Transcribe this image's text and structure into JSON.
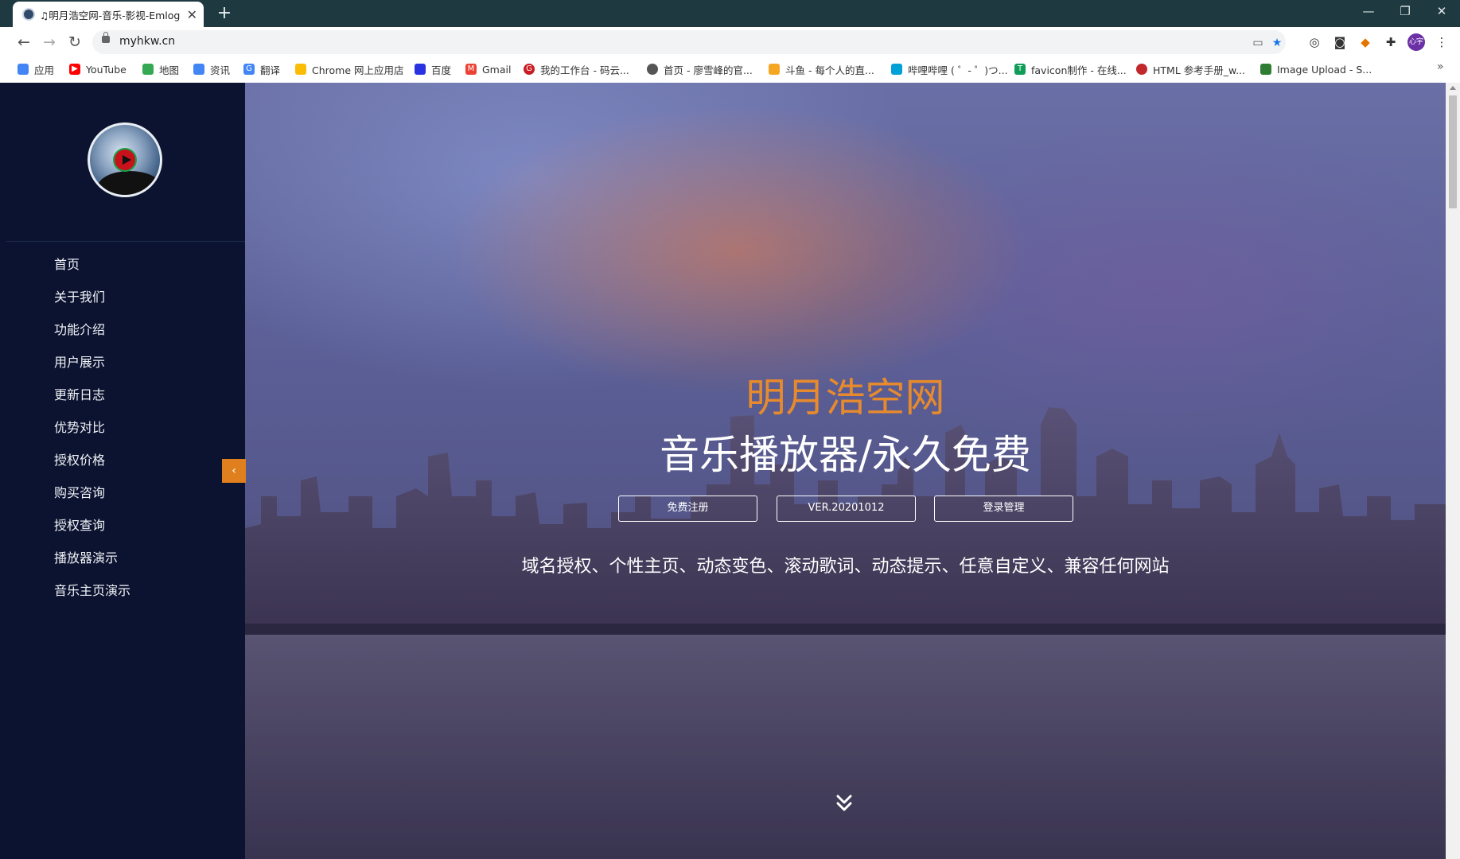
{
  "browser": {
    "tab_title": "♫明月浩空网-音乐-影视-Emlog",
    "url": "myhkw.cn",
    "new_tab_label": "+",
    "close_glyph": "✕",
    "profile_label": "心宇",
    "bookmarks": [
      {
        "label": "应用",
        "icon": "apps-grid-icon",
        "color": "#4285f4"
      },
      {
        "label": "YouTube",
        "icon": "youtube-icon",
        "color": "#ff0000"
      },
      {
        "label": "地图",
        "icon": "maps-icon",
        "color": "#34a853"
      },
      {
        "label": "资讯",
        "icon": "news-icon",
        "color": "#4285f4"
      },
      {
        "label": "翻译",
        "icon": "translate-icon",
        "color": "#4285f4"
      },
      {
        "label": "Chrome 网上应用店",
        "icon": "webstore-icon",
        "color": "#fbbc05"
      },
      {
        "label": "百度",
        "icon": "baidu-icon",
        "color": "#2932e1"
      },
      {
        "label": "Gmail",
        "icon": "gmail-icon",
        "color": "#ea4335"
      },
      {
        "label": "我的工作台 - 码云...",
        "icon": "gitee-icon",
        "color": "#c71d23"
      },
      {
        "label": "首页 - 廖雪峰的官...",
        "icon": "globe-icon",
        "color": "#555555"
      },
      {
        "label": "斗鱼 - 每个人的直...",
        "icon": "douyu-icon",
        "color": "#f5a623"
      },
      {
        "label": "哔哩哔哩 ( ゜- ゜)つ...",
        "icon": "bilibili-icon",
        "color": "#00a1d6"
      },
      {
        "label": "favicon制作 - 在线...",
        "icon": "favicon-icon",
        "color": "#0f9d58"
      },
      {
        "label": "HTML 参考手册_w...",
        "icon": "w3school-icon",
        "color": "#c1272d"
      },
      {
        "label": "Image Upload - S...",
        "icon": "bar-chart-icon",
        "color": "#2e7d32"
      }
    ],
    "more_glyph": "»"
  },
  "sidebar": {
    "menu": [
      "首页",
      "关于我们",
      "功能介绍",
      "用户展示",
      "更新日志",
      "优势对比",
      "授权价格",
      "购买咨询",
      "授权查询",
      "播放器演示",
      "音乐主页演示"
    ],
    "collapse_glyph": "‹"
  },
  "hero": {
    "title": "明月浩空网",
    "subtitle": "音乐播放器/永久免费",
    "buttons": [
      "免费注册",
      "VER.20201012",
      "登录管理"
    ],
    "features": "域名授权、个性主页、动态变色、滚动歌词、动态提示、任意自定义、兼容任何网站"
  },
  "colors": {
    "sidebar_bg": "#0b1330",
    "accent": "#e07f1e",
    "title_orange": "#e78a2e"
  }
}
